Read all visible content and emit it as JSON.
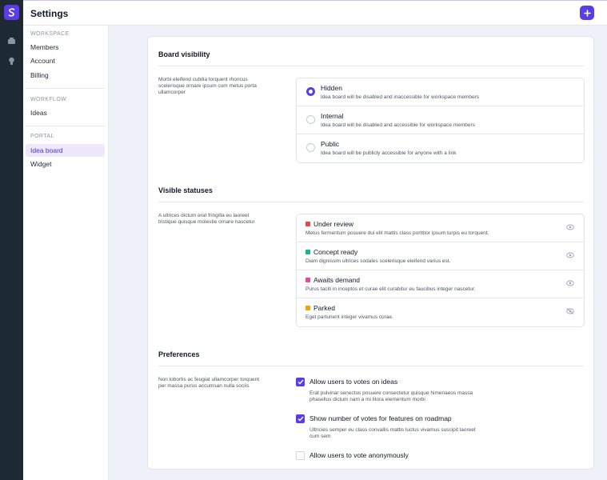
{
  "app": {
    "title": "Settings"
  },
  "sidenav": {
    "sections": [
      {
        "head": "WORKSPACE",
        "items": [
          "Members",
          "Account",
          "Billing"
        ]
      },
      {
        "head": "WORKFLOW",
        "items": [
          "Ideas"
        ]
      },
      {
        "head": "PORTAL",
        "items": [
          "Idea board",
          "Widget"
        ]
      }
    ],
    "active": "Idea board"
  },
  "visibility": {
    "title": "Board visibility",
    "desc": "Morbi eleifend cubilia torquent rhoncus scelerisque ornare ipsum cum metus porta ullamcorper",
    "selected": "Hidden",
    "options": [
      {
        "label": "Hidden",
        "sub": "Idea board will be disabled and inaccessible for workspace members"
      },
      {
        "label": "Internal",
        "sub": "Idea board will be disabled and accessible for workspace members"
      },
      {
        "label": "Public",
        "sub": "Idea board will be publicly accessible for anyone with a link"
      }
    ]
  },
  "statuses": {
    "title": "Visible statuses",
    "desc": "A ultrices dictum erat fringilla eu laoreet tristique quisque molestie ornare nascetur",
    "items": [
      {
        "label": "Under review",
        "sub": "Metus fermentum posuere dui elit mattis class porttitor ipsum turpis eu torquent.",
        "color": "#ef4444",
        "visible": true
      },
      {
        "label": "Concept ready",
        "sub": "Diam dignissim ultrices sodales scelerisque eleifend varius est.",
        "color": "#10b981",
        "visible": true
      },
      {
        "label": "Awaits demand",
        "sub": "Purus taciti in inceptos et curae elit curabitur eu faucibus integer nascetur.",
        "color": "#ec4899",
        "visible": true
      },
      {
        "label": "Parked",
        "sub": "Eget parturient integer vivamus curae.",
        "color": "#f59e0b",
        "visible": false
      }
    ]
  },
  "preferences": {
    "title": "Preferences",
    "desc": "Non lobortis ac feugiat ullamcorper torquent per massa purus accumsan nulla sociis",
    "items": [
      {
        "label": "Allow users to votes on ideas",
        "sub": "Erat pulvinar senectus posuere consectetur quisque himenaeos massa phasellus dictum nam a mi litora elementum morbi",
        "checked": true
      },
      {
        "label": "Show number of votes for features on roadmap",
        "sub": "Ultricies semper eu class convallis mattis luctus vivamus suscipit laoreet cum sem",
        "checked": true
      },
      {
        "label": "Allow users to vote anonymously",
        "sub": "",
        "checked": false
      }
    ]
  },
  "colors": {
    "accent": "#5b3de8",
    "rail": "#1e2a33"
  }
}
